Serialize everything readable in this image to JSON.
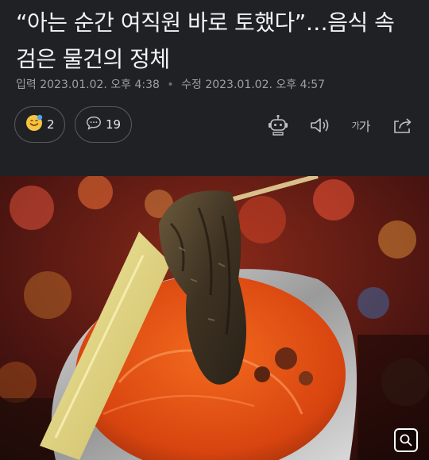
{
  "article": {
    "headline": "“아는 순간 여직원 바로 토했다”…음식 속 검은 물건의 정체",
    "posted_label": "입력",
    "posted_time": "2023.01.02. 오후 4:38",
    "updated_label": "수정",
    "updated_time": "2023.01.02. 오후 4:57"
  },
  "reactions": {
    "emoji_icon": "smiley-face-icon",
    "count": "2"
  },
  "comments": {
    "icon": "speech-bubble-icon",
    "count": "19"
  },
  "tools": {
    "bot_icon": "robot-icon",
    "audio_icon": "speaker-icon",
    "font_small": "가",
    "font_large": "가",
    "share_icon": "share-icon"
  },
  "image": {
    "zoom_icon": "zoom-icon"
  },
  "colors": {
    "background": "#202124",
    "text": "#f1f3f4",
    "muted": "#9aa0a6",
    "pill_border": "#55585d",
    "emoji": "#f5c542"
  }
}
